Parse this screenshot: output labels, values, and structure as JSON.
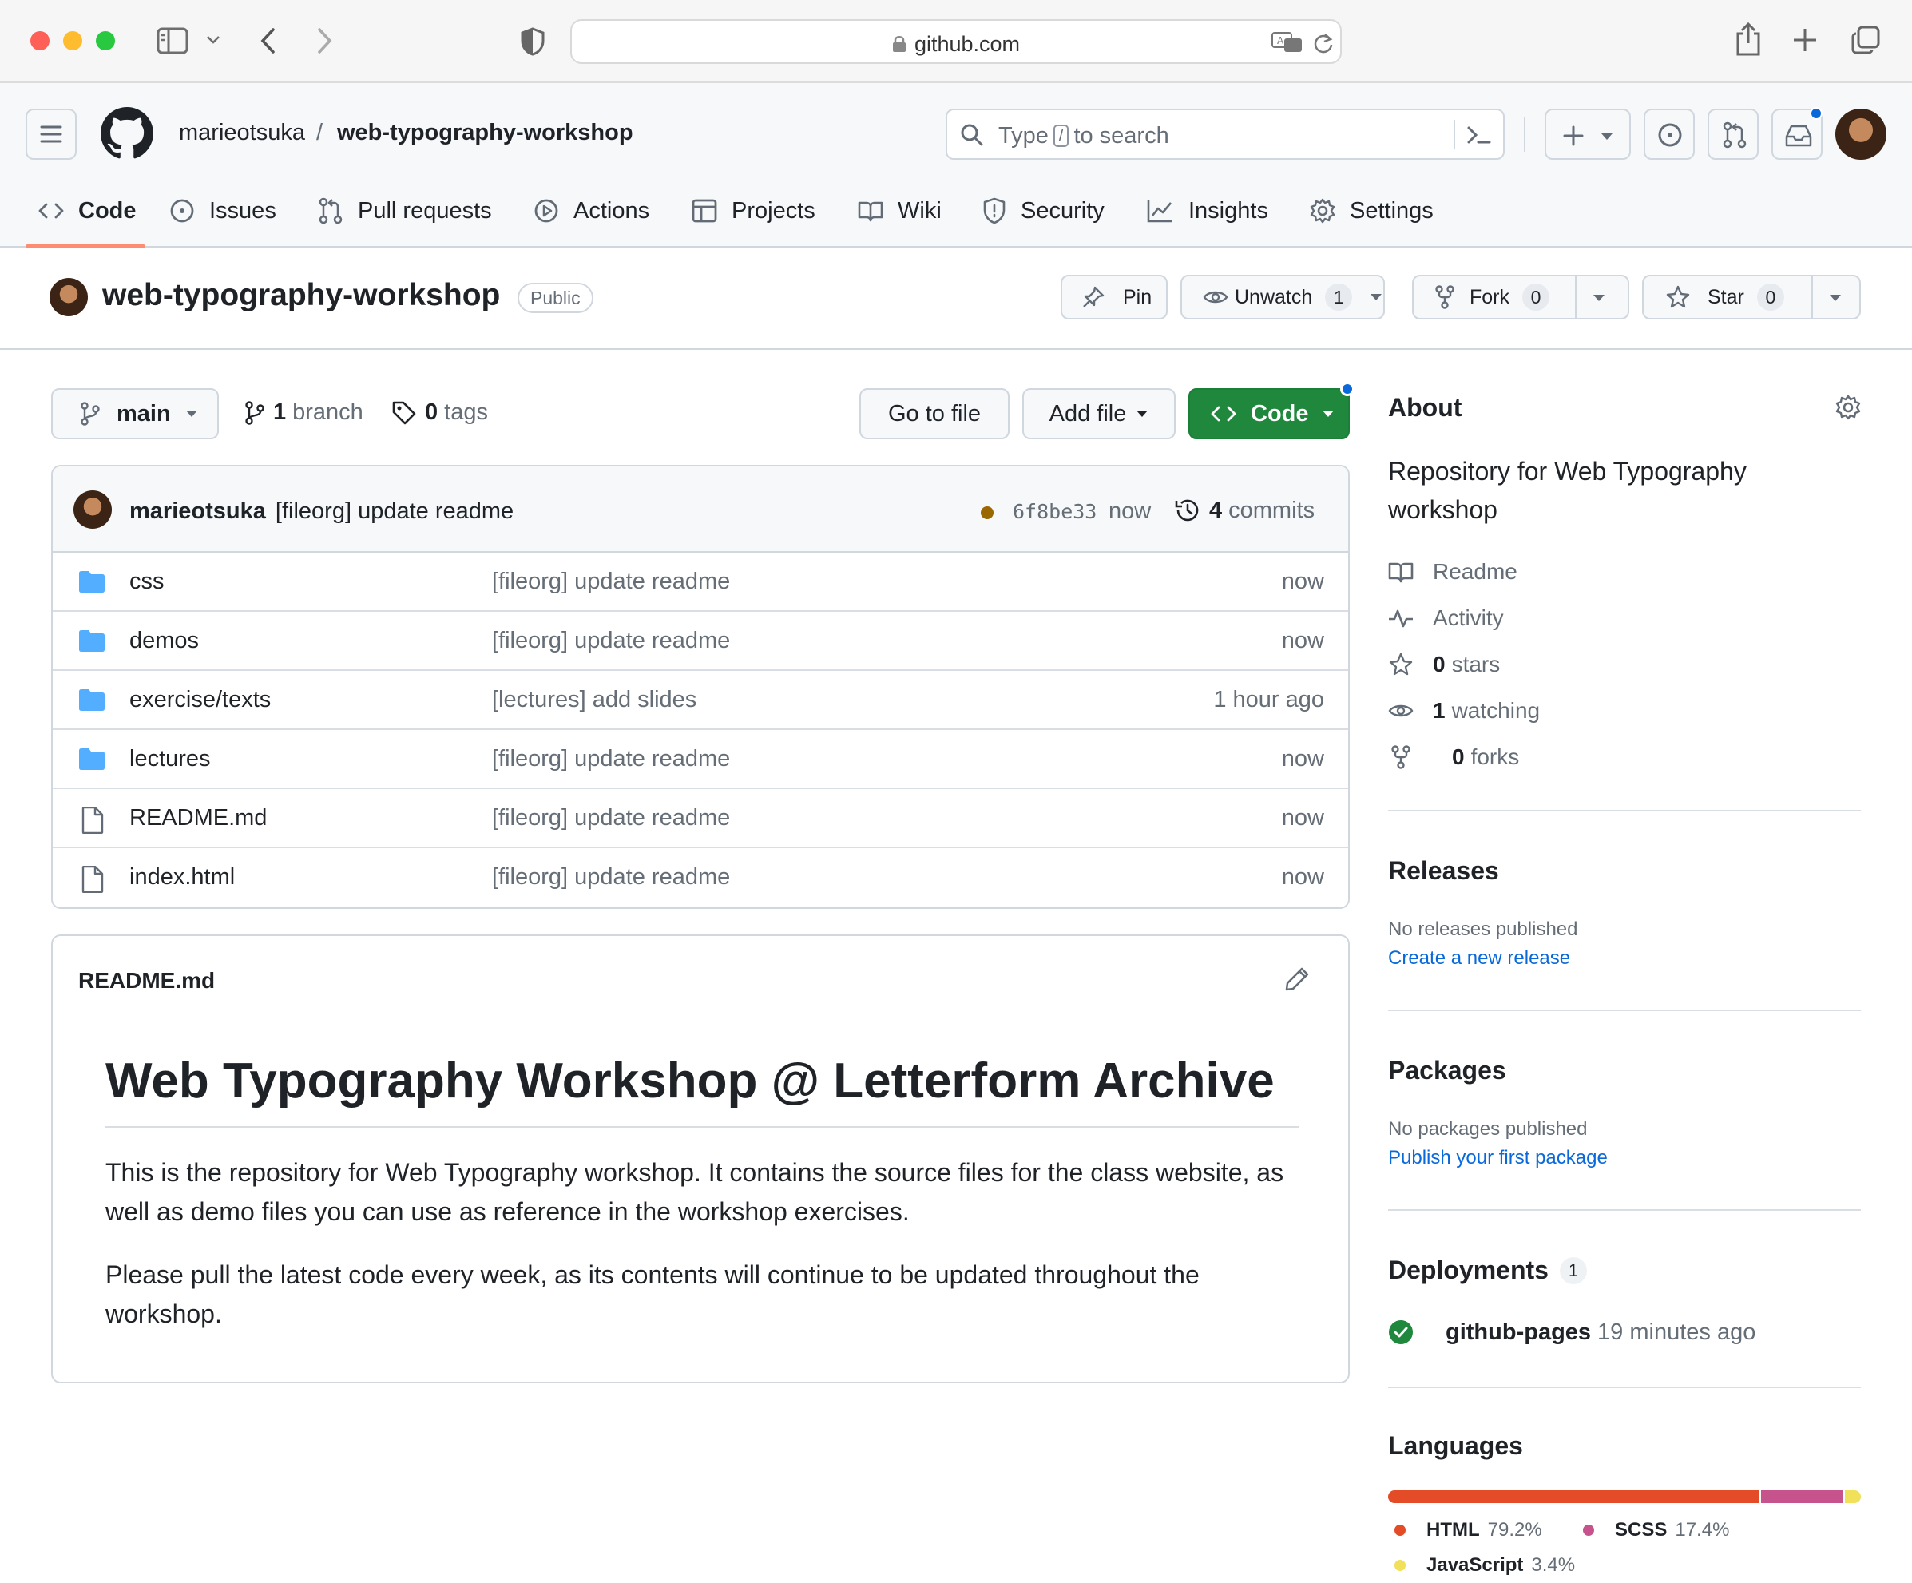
{
  "browser": {
    "url": "github.com",
    "traffic_colors": [
      "#fe5f57",
      "#febc2e",
      "#28c840"
    ]
  },
  "header": {
    "owner": "marieotsuka",
    "separator": "/",
    "repo": "web-typography-workshop",
    "search_prefix": "Type",
    "search_key": "/",
    "search_suffix": "to search"
  },
  "tabs": [
    {
      "label": "Code",
      "icon": "code-icon",
      "active": true
    },
    {
      "label": "Issues",
      "icon": "issue-icon"
    },
    {
      "label": "Pull requests",
      "icon": "pull-request-icon"
    },
    {
      "label": "Actions",
      "icon": "play-icon"
    },
    {
      "label": "Projects",
      "icon": "table-icon"
    },
    {
      "label": "Wiki",
      "icon": "book-icon"
    },
    {
      "label": "Security",
      "icon": "shield-icon"
    },
    {
      "label": "Insights",
      "icon": "graph-icon"
    },
    {
      "label": "Settings",
      "icon": "gear-icon"
    }
  ],
  "repo": {
    "name": "web-typography-workshop",
    "visibility": "Public",
    "pin_label": "Pin",
    "watch_label": "Unwatch",
    "watch_count": "1",
    "fork_label": "Fork",
    "fork_count": "0",
    "star_label": "Star",
    "star_count": "0"
  },
  "browser_bar": {
    "branch": "main",
    "branch_count": "1",
    "branch_label": "branch",
    "tag_count": "0",
    "tag_label": "tags",
    "goto_label": "Go to file",
    "add_label": "Add file",
    "code_label": "Code"
  },
  "commit": {
    "author": "marieotsuka",
    "message": "[fileorg] update readme",
    "sha": "6f8be33",
    "time": "now",
    "count": "4",
    "count_label": "commits",
    "status_color": "#9a6700"
  },
  "files": [
    {
      "name": "css",
      "type": "folder",
      "message": "[fileorg] update readme",
      "age": "now"
    },
    {
      "name": "demos",
      "type": "folder",
      "message": "[fileorg] update readme",
      "age": "now"
    },
    {
      "name": "exercise/texts",
      "type": "folder",
      "message": "[lectures] add slides",
      "age": "1 hour ago"
    },
    {
      "name": "lectures",
      "type": "folder",
      "message": "[fileorg] update readme",
      "age": "now"
    },
    {
      "name": "README.md",
      "type": "file",
      "message": "[fileorg] update readme",
      "age": "now"
    },
    {
      "name": "index.html",
      "type": "file",
      "message": "[fileorg] update readme",
      "age": "now"
    }
  ],
  "readme": {
    "filename": "README.md",
    "heading": "Web Typography Workshop @ Letterform Archive",
    "p1": "This is the repository for Web Typography workshop. It contains the source files for the class website, as well as demo files you can use as reference in the workshop exercises.",
    "p2": "Please pull the latest code every week, as its contents will continue to be updated throughout the workshop."
  },
  "sidebar": {
    "about_title": "About",
    "description": "Repository for Web Typography workshop",
    "readme_label": "Readme",
    "activity_label": "Activity",
    "stars_count": "0",
    "stars_label": "stars",
    "watching_count": "1",
    "watching_label": "watching",
    "forks_count": "0",
    "forks_label": "forks",
    "releases_title": "Releases",
    "releases_empty": "No releases published",
    "releases_link": "Create a new release",
    "packages_title": "Packages",
    "packages_empty": "No packages published",
    "packages_link": "Publish your first package",
    "deployments_title": "Deployments",
    "deployments_count": "1",
    "deployment_name": "github-pages",
    "deployment_time": "19 minutes ago",
    "languages_title": "Languages"
  },
  "languages": [
    {
      "name": "HTML",
      "percent": "79.2%",
      "value": 79.2,
      "color": "#e34c26"
    },
    {
      "name": "SCSS",
      "percent": "17.4%",
      "value": 17.4,
      "color": "#c6538c"
    },
    {
      "name": "JavaScript",
      "percent": "3.4%",
      "value": 3.4,
      "color": "#f1e05a"
    }
  ]
}
